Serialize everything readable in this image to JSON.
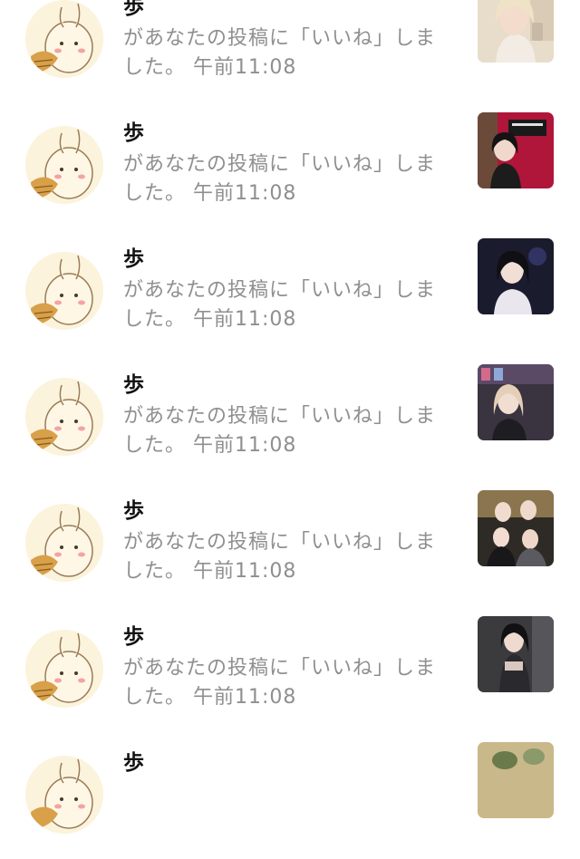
{
  "notifications": [
    {
      "user": "歩",
      "message": "があなたの投稿に「いいね」しました。",
      "time": "午前11:08",
      "thumb_color": "#e8dccb"
    },
    {
      "user": "歩",
      "message": "があなたの投稿に「いいね」しました。",
      "time": "午前11:08",
      "thumb_color": "#b0163a"
    },
    {
      "user": "歩",
      "message": "があなたの投稿に「いいね」しました。",
      "time": "午前11:08",
      "thumb_color": "#1b1b2e"
    },
    {
      "user": "歩",
      "message": "があなたの投稿に「いいね」しました。",
      "time": "午前11:08",
      "thumb_color": "#3a3340"
    },
    {
      "user": "歩",
      "message": "があなたの投稿に「いいね」しました。",
      "time": "午前11:08",
      "thumb_color": "#2e2a26"
    },
    {
      "user": "歩",
      "message": "があなたの投稿に「いいね」しました。",
      "time": "午前11:08",
      "thumb_color": "#3b3b3d"
    },
    {
      "user": "歩",
      "message": "",
      "time": "",
      "thumb_color": "#c9b88a"
    }
  ]
}
